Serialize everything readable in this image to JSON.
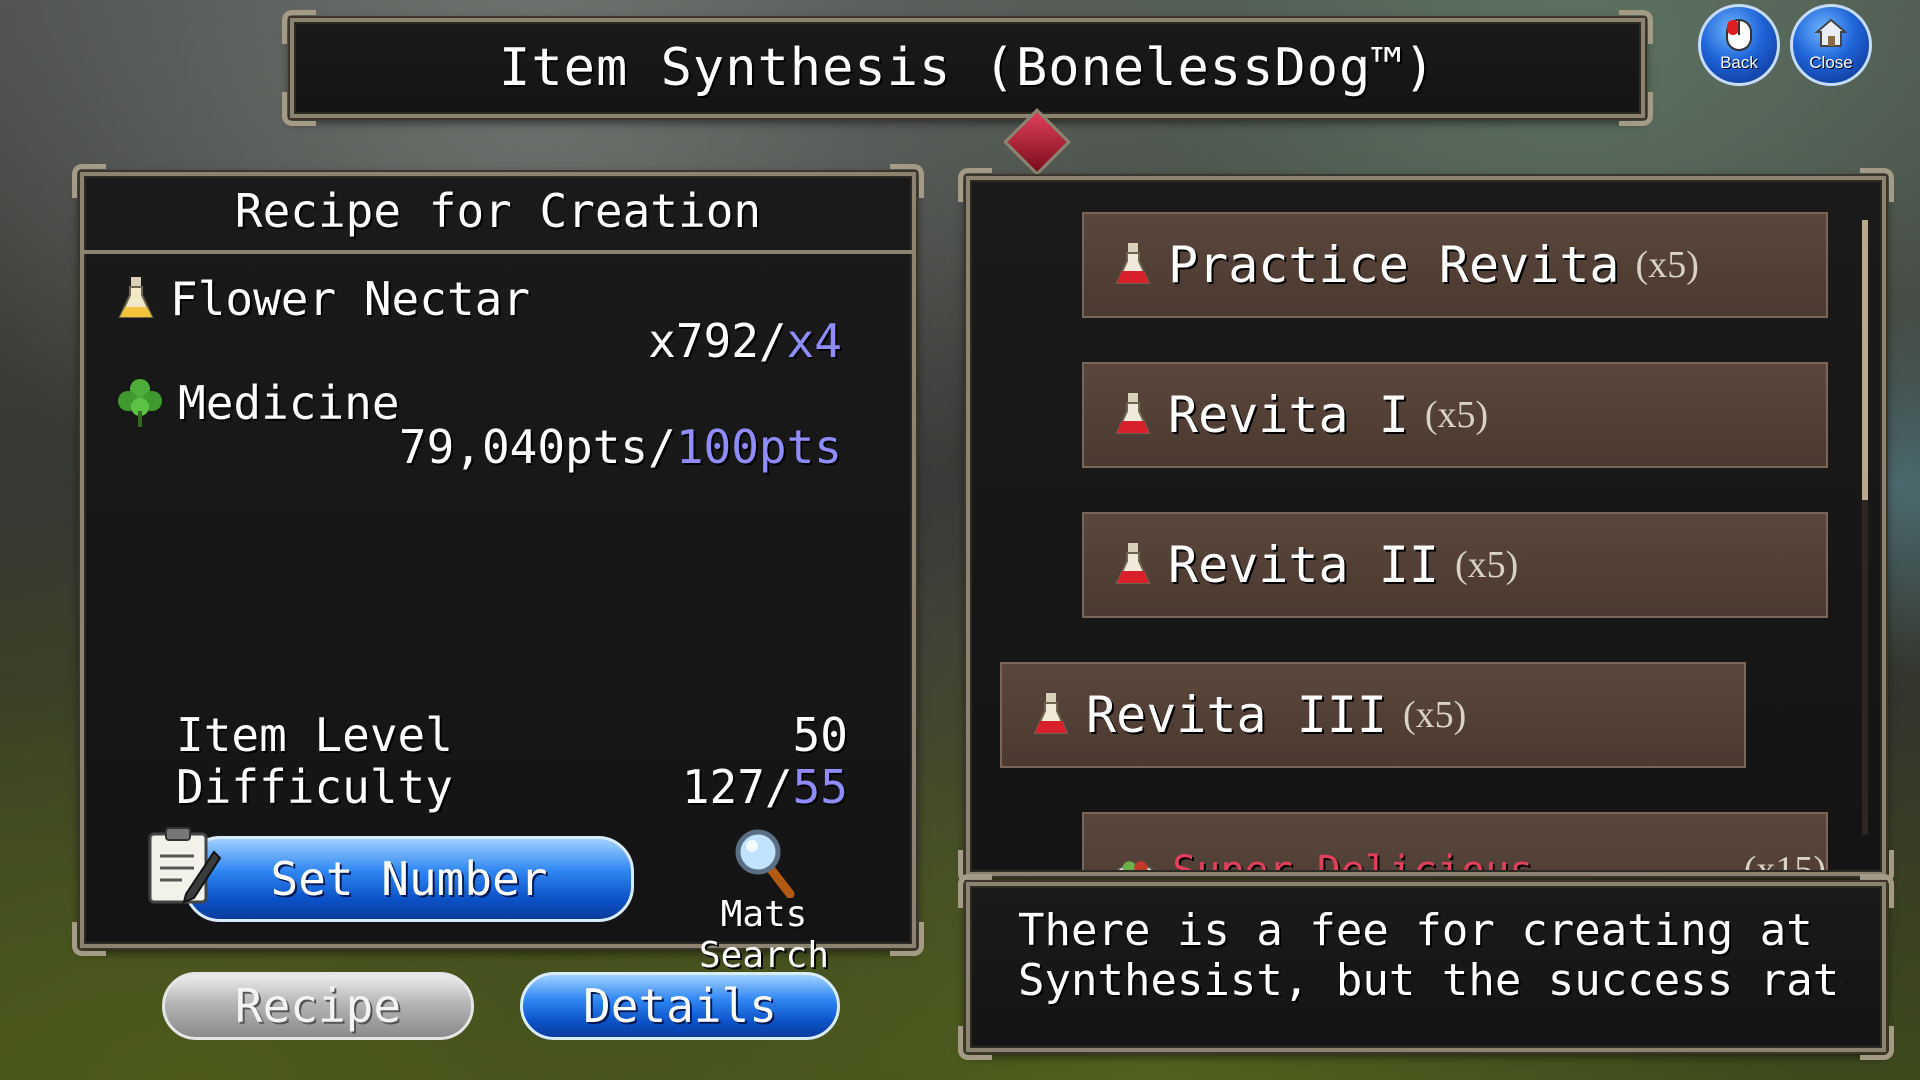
{
  "window": {
    "title": "Item Synthesis (BonelessDog™)"
  },
  "nav": {
    "back_label": "Back",
    "close_label": "Close",
    "back_icon": "mouse-icon",
    "close_icon": "home-icon",
    "button_color": "#1f64d8"
  },
  "recipe": {
    "heading": "Recipe for Creation",
    "materials": [
      {
        "name": "Flower Nectar",
        "icon": "potion-bottle-icon",
        "have": "x792/",
        "need": "x4"
      },
      {
        "name": "Medicine",
        "icon": "herb-clover-icon",
        "have": "79,040pts/",
        "need": "100pts"
      }
    ],
    "stats": [
      {
        "label": "Item Level",
        "value": "50",
        "required": ""
      },
      {
        "label": "Difficulty",
        "value": "127/",
        "required": "55"
      }
    ],
    "set_number_label": "Set Number",
    "mats_search_label": "Mats Search"
  },
  "tabs": {
    "recipe_label": "Recipe",
    "details_label": "Details"
  },
  "items": [
    {
      "name": "Practice Revita",
      "qty": "(x5)",
      "icon": "red-potion-icon"
    },
    {
      "name": "Revita I",
      "qty": "(x5)",
      "icon": "red-potion-icon"
    },
    {
      "name": "Revita II",
      "qty": "(x5)",
      "icon": "red-potion-icon"
    },
    {
      "name": "Revita III",
      "qty": "(x5)",
      "icon": "red-potion-icon",
      "selected": true
    },
    {
      "name": "Super Delicious Yakitori",
      "qty": "(x15)",
      "icon": "food-plate-icon"
    }
  ],
  "description": {
    "line1": "There is a fee for creating at the",
    "line2": "Synthesist, but the success rate i"
  },
  "colors": {
    "accent_need": "#8f8cff",
    "panel_border": "#8c8471",
    "item_bg": "#4b3a31",
    "partial_item_text": "#e0405a"
  }
}
